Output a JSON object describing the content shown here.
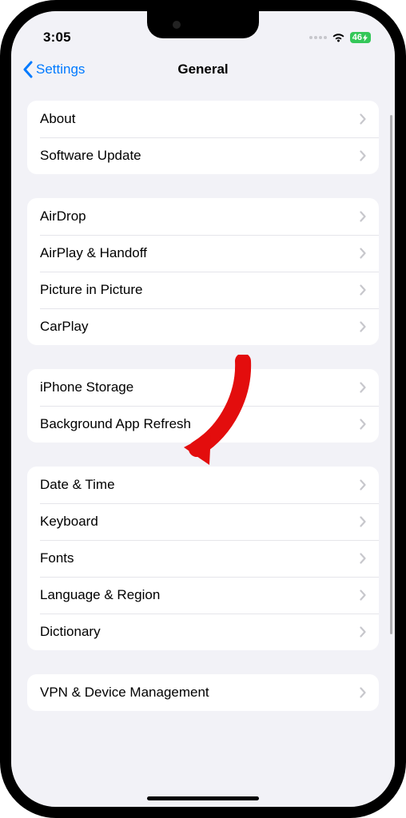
{
  "status": {
    "time": "3:05",
    "battery": "46"
  },
  "nav": {
    "back_label": "Settings",
    "title": "General"
  },
  "groups": [
    {
      "items": [
        {
          "label": "About",
          "name": "row-about"
        },
        {
          "label": "Software Update",
          "name": "row-software-update"
        }
      ]
    },
    {
      "items": [
        {
          "label": "AirDrop",
          "name": "row-airdrop"
        },
        {
          "label": "AirPlay & Handoff",
          "name": "row-airplay-handoff"
        },
        {
          "label": "Picture in Picture",
          "name": "row-picture-in-picture"
        },
        {
          "label": "CarPlay",
          "name": "row-carplay"
        }
      ]
    },
    {
      "items": [
        {
          "label": "iPhone Storage",
          "name": "row-iphone-storage"
        },
        {
          "label": "Background App Refresh",
          "name": "row-background-app-refresh"
        }
      ]
    },
    {
      "items": [
        {
          "label": "Date & Time",
          "name": "row-date-time"
        },
        {
          "label": "Keyboard",
          "name": "row-keyboard"
        },
        {
          "label": "Fonts",
          "name": "row-fonts"
        },
        {
          "label": "Language & Region",
          "name": "row-language-region"
        },
        {
          "label": "Dictionary",
          "name": "row-dictionary"
        }
      ]
    },
    {
      "items": [
        {
          "label": "VPN & Device Management",
          "name": "row-vpn-device-management"
        }
      ]
    }
  ],
  "annotation": {
    "color": "#e30d0d"
  }
}
